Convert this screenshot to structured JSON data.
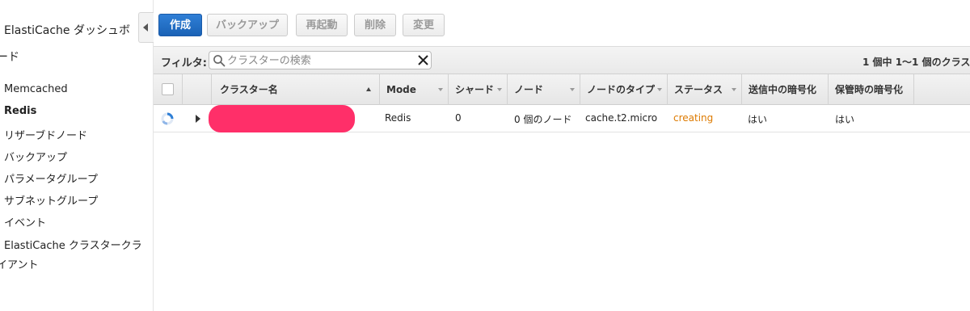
{
  "sidebar": {
    "title_line1": "ElastiCache ダッシュボ",
    "title_line2": "ード",
    "items": [
      {
        "label": "Memcached",
        "active": false
      },
      {
        "label": "Redis",
        "active": true
      },
      {
        "label": "リザーブドノード",
        "active": false
      },
      {
        "label": "バックアップ",
        "active": false
      },
      {
        "label": "パラメータグループ",
        "active": false
      },
      {
        "label": "サブネットグループ",
        "active": false
      },
      {
        "label": "イベント",
        "active": false
      },
      {
        "label": "ElastiCache クラスタークラ",
        "active": false
      }
    ],
    "last_item_wrap": "イアント"
  },
  "toolbar": {
    "create_label": "作成",
    "backup_label": "バックアップ",
    "reboot_label": "再起動",
    "delete_label": "削除",
    "modify_label": "変更"
  },
  "filter": {
    "label": "フィルタ:",
    "placeholder": "クラスターの検索",
    "page_info": "1 個中 1〜1 個のクラス"
  },
  "table": {
    "columns": [
      "クラスター名",
      "Mode",
      "シャード",
      "ノード",
      "ノードのタイプ",
      "ステータス",
      "送信中の暗号化",
      "保管時の暗号化"
    ],
    "rows": [
      {
        "name": "",
        "mode": "Redis",
        "shards": "0",
        "nodes": "0 個のノード",
        "node_type": "cache.t2.micro",
        "status": "creating",
        "encryption_in_transit": "はい",
        "encryption_at_rest": "はい"
      }
    ]
  },
  "colors": {
    "primary": "#1a62b6",
    "status_creating": "#dd7a00",
    "redaction": "#ff2f69"
  }
}
